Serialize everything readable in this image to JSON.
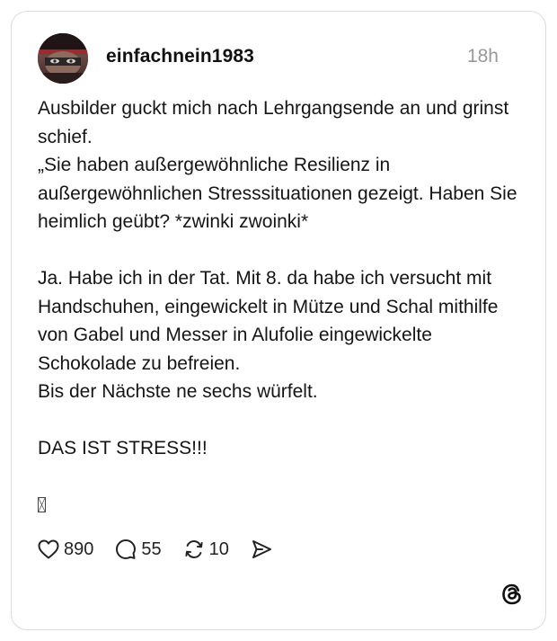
{
  "post": {
    "username": "einfachnein1983",
    "timestamp": "18h",
    "text": "Ausbilder guckt mich nach Lehrgangsende an und grinst schief.\n„Sie haben außergewöhnliche Resilienz in außergewöhnlichen Stresssituationen gezeigt. Haben Sie heimlich geübt? *zwinki zwoinki*\n\nJa. Habe ich in der Tat. Mit 8. da habe ich versucht mit Handschuhen, eingewickelt in Mütze und Schal mithilfe von Gabel und Messer in Alufolie eingewickelte Schokolade zu befreien.\nBis der Nächste ne sechs würfelt.\n\nDAS IST STRESS!!!"
  },
  "actions": {
    "likes": "890",
    "replies": "55",
    "reposts": "10"
  },
  "icons": {
    "like": "heart-icon",
    "reply": "comment-bubble-icon",
    "repost": "repost-arrows-icon",
    "share": "send-icon",
    "brand": "threads-logo-icon",
    "unknown_glyph": "missing-glyph-box-icon"
  },
  "colors": {
    "timestamp": "#999999",
    "border": "#dcdcdc",
    "text": "#151515"
  }
}
